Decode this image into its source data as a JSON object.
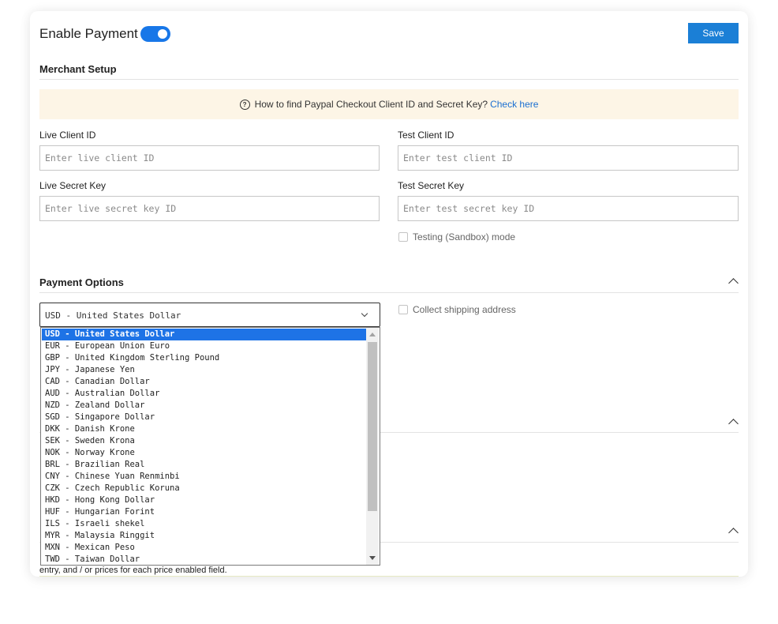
{
  "header": {
    "enable_payment_label": "Enable Payment",
    "enable_payment_on": true,
    "save_label": "Save"
  },
  "merchant_setup": {
    "title": "Merchant Setup",
    "notice_text": "How to find Paypal Checkout Client ID and Secret Key?",
    "notice_link": "Check here",
    "live_client_id": {
      "label": "Live Client ID",
      "placeholder": "Enter live client ID",
      "value": ""
    },
    "test_client_id": {
      "label": "Test Client ID",
      "placeholder": "Enter test client ID",
      "value": ""
    },
    "live_secret_key": {
      "label": "Live Secret Key",
      "placeholder": "Enter live secret key ID",
      "value": ""
    },
    "test_secret_key": {
      "label": "Test Secret Key",
      "placeholder": "Enter test secret key ID",
      "value": ""
    },
    "sandbox_label": "Testing (Sandbox) mode",
    "sandbox_checked": false
  },
  "payment_options": {
    "title": "Payment Options",
    "currency_selected": "USD - United States Dollar",
    "collect_shipping_label": "Collect shipping address",
    "collect_shipping_checked": false,
    "currency_options": [
      "USD - United States Dollar",
      "EUR - European Union Euro",
      "GBP - United Kingdom Sterling Pound",
      "JPY - Japanese Yen",
      "CAD - Canadian Dollar",
      "AUD - Australian Dollar",
      "NZD - Zealand Dollar",
      "SGD - Singapore Dollar",
      "DKK - Danish Krone",
      "SEK - Sweden Krona",
      "NOK - Norway Krone",
      "BRL - Brazilian Real",
      "CNY - Chinese Yuan Renminbi",
      "CZK - Czech Republic Koruna",
      "HKD - Hong Kong Dollar",
      "HUF - Hungarian Forint",
      "ILS - Israeli shekel",
      "MYR - Malaysia Ringgit",
      "MXN - Mexican Peso",
      "TWD - Taiwan Dollar"
    ]
  },
  "partially_hidden": {
    "bottom_text": "entry, and / or prices for each price enabled field."
  },
  "icons": {
    "help": "question-circle-icon",
    "collapse": "chevron-up-icon",
    "dropdown": "chevron-down-icon"
  },
  "colors": {
    "accent": "#1877e8",
    "save_button": "#1b7fd6",
    "notice_bg": "#fdf5e6",
    "link": "#1a6fd1",
    "selected_option": "#1e73e6"
  }
}
